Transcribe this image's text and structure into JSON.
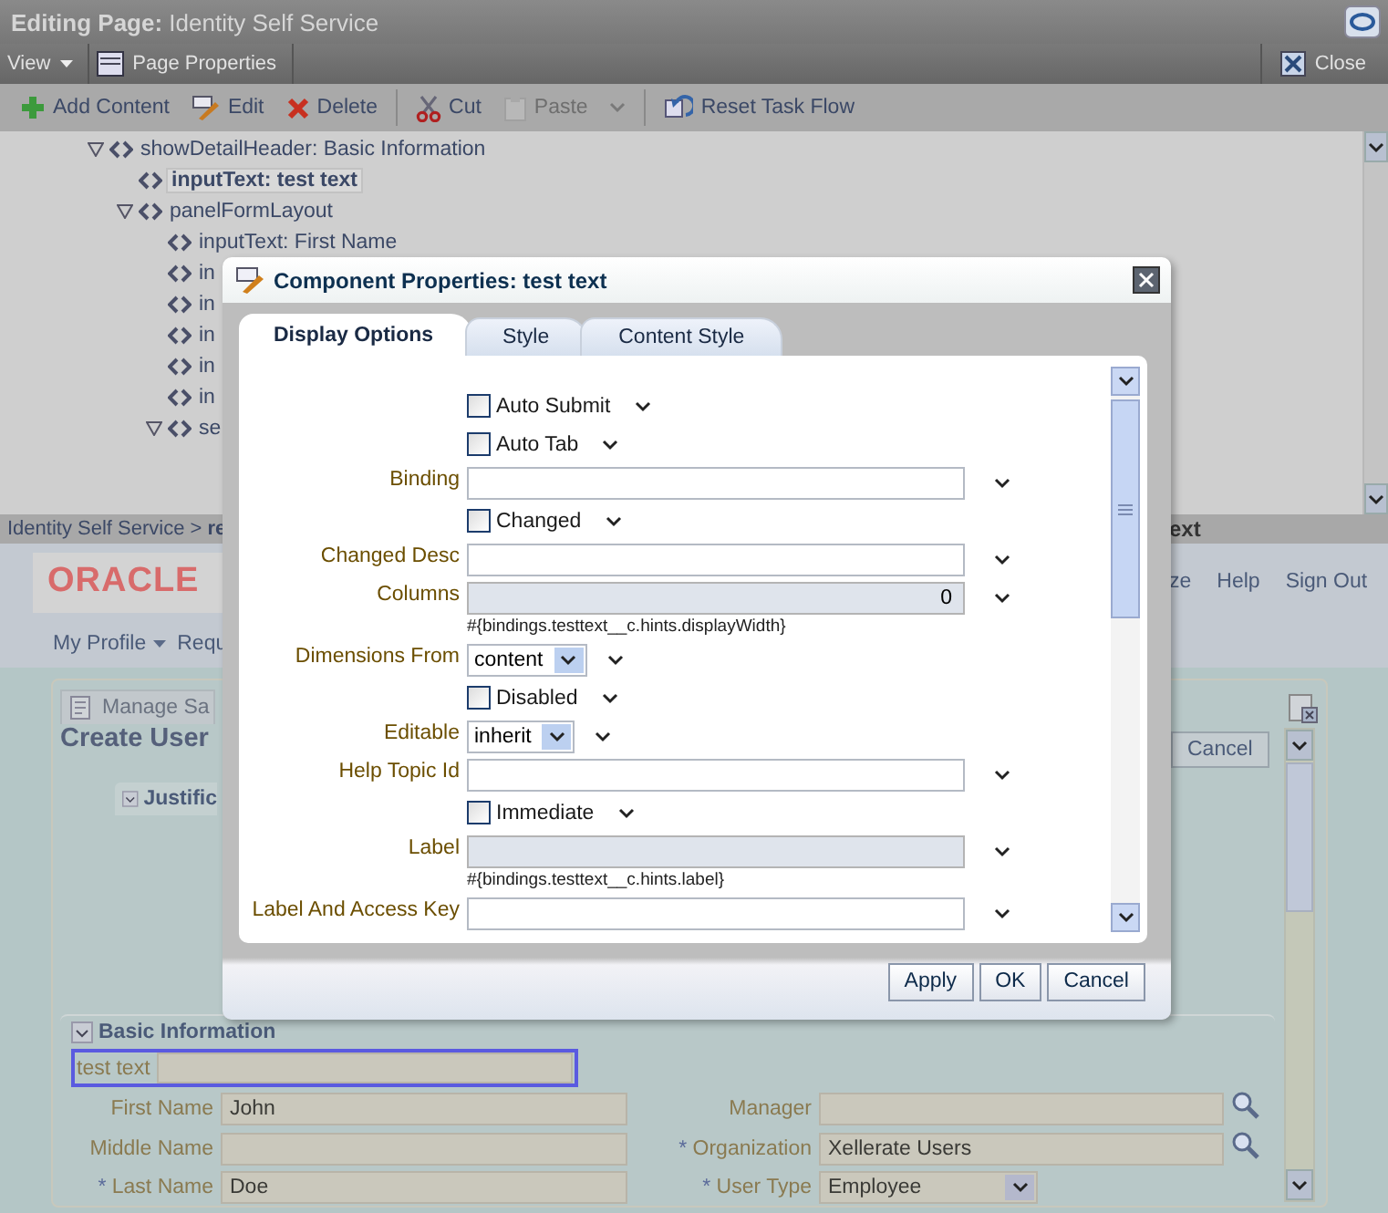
{
  "title_bar": {
    "title": "**Editing Page:** Identity Self Service"
  },
  "menu_bar": {
    "view_menu": "View",
    "page_properties": "Page Properties",
    "close": "Close"
  },
  "toolbar": {
    "groups": [
      [
        {
          "kind": "button",
          "label": "Add Content",
          "disabled": false
        },
        {
          "kind": "button",
          "label": "Edit",
          "disabled": false
        },
        {
          "kind": "button",
          "label": "Delete",
          "disabled": false
        }
      ],
      [
        {
          "kind": "button",
          "label": "Cut",
          "disabled": false
        },
        {
          "kind": "button",
          "label": "Paste",
          "disabled": true
        },
        {
          "kind": "dropdown",
          "disabled": true
        }
      ],
      [
        {
          "kind": "button",
          "label": "Reset Task Flow",
          "disabled": false
        }
      ]
    ]
  },
  "tree": [
    {
      "label": "showDetailHeader: Basic Information",
      "expanded": true,
      "selected": false,
      "children": [
        {
          "label": "inputText: test text",
          "selected": true
        },
        {
          "label": "panelFormLayout",
          "expanded": true,
          "selected": false,
          "children": [
            {
              "label": "inputText: First Name",
              "selected": false
            },
            {
              "label": "in",
              "selected": false
            },
            {
              "label": "in",
              "selected": false
            },
            {
              "label": "in",
              "selected": false
            },
            {
              "label": "in",
              "selected": false
            },
            {
              "label": "in",
              "selected": false
            },
            {
              "label": "se",
              "expanded": true,
              "selected": false
            }
          ]
        }
      ]
    }
  ],
  "breadcrumb": {
    "path": "Identity Self Service > **re**",
    "title_end": "ext"
  },
  "app_header": {
    "logo": "ORACLE",
    "nav_links": [
      "ze",
      "Help",
      "Sign Out"
    ],
    "menus": [
      {
        "label": "My Profile",
        "dropdown": true
      },
      {
        "label": "Requ",
        "dropdown": false
      }
    ]
  },
  "card": {
    "tab": "Manage Sa",
    "title": "Create User",
    "cancel": "Cancel",
    "section": "Justific"
  },
  "basic_info": {
    "title": "Basic Information",
    "expanded": true,
    "focused_field": {
      "label": "test text",
      "selected": true
    },
    "fields": [
      {
        "kind": "text",
        "label": "First Name",
        "value": "John"
      },
      {
        "kind": "lookup",
        "label": "Manager"
      },
      {
        "kind": "text",
        "label": "Middle Name"
      },
      {
        "kind": "lookup",
        "mark": "*",
        "label": "Organization",
        "value": "Xellerate Users"
      },
      {
        "kind": "text",
        "mark": "*",
        "label": "Last Name",
        "value": "Doe"
      },
      {
        "kind": "select",
        "mark": "*",
        "label": "User Type",
        "value": "Employee"
      }
    ]
  },
  "dialog": {
    "title": "Component Properties: test text",
    "tabs": [
      {
        "label": "Display Options",
        "selected": true
      },
      {
        "label": "Style",
        "selected": false
      },
      {
        "label": "Content Style",
        "selected": false
      }
    ],
    "properties": [
      {
        "kind": "checkbox",
        "label": "Auto Submit",
        "checked": false
      },
      {
        "kind": "checkbox",
        "label": "Auto Tab",
        "checked": false
      },
      {
        "kind": "text",
        "label": "Binding",
        "disabled": false
      },
      {
        "kind": "checkbox",
        "label": "Changed",
        "checked": false
      },
      {
        "kind": "text",
        "label": "Changed Desc",
        "disabled": false
      },
      {
        "kind": "text",
        "label": "Columns",
        "value": "0",
        "disabled": true,
        "hint": "#{bindings.testtext__c.hints.displayWidth}"
      },
      {
        "kind": "select",
        "label": "Dimensions From",
        "value": "content"
      },
      {
        "kind": "checkbox",
        "label": "Disabled",
        "checked": false
      },
      {
        "kind": "select",
        "label": "Editable",
        "value": "inherit"
      },
      {
        "kind": "text",
        "label": "Help Topic Id",
        "disabled": false
      },
      {
        "kind": "checkbox",
        "label": "Immediate",
        "checked": false
      },
      {
        "kind": "text",
        "label": "Label",
        "disabled": true,
        "hint": "#{bindings.testtext__c.hints.label}"
      },
      {
        "kind": "text",
        "label": "Label And Access Key",
        "disabled": false
      }
    ],
    "buttons": [
      "Apply",
      "OK",
      "Cancel"
    ]
  }
}
